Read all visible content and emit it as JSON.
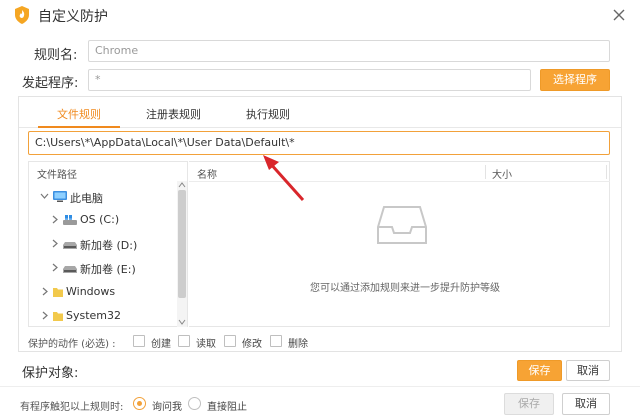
{
  "window": {
    "title": "自定义防护",
    "close_icon": "close-icon",
    "app_icon": "shield-icon",
    "app_icon_color": "#f5a623"
  },
  "form": {
    "rule_name_label": "规则名:",
    "rule_name_value": "Chrome",
    "process_label": "发起程序:",
    "process_value": "*",
    "select_program_button": "选择程序"
  },
  "tabs": [
    {
      "label": "文件规则",
      "active": true
    },
    {
      "label": "注册表规则",
      "active": false
    },
    {
      "label": "执行规则",
      "active": false
    }
  ],
  "path_input": {
    "value": "C:\\Users\\*\\AppData\\Local\\*\\User Data\\Default\\*"
  },
  "tree": {
    "header": "文件路径",
    "items": [
      {
        "label": "此电脑",
        "icon": "computer-icon",
        "caret": "expanded"
      },
      {
        "label": "OS (C:)",
        "icon": "os-drive-icon",
        "caret": "collapsed"
      },
      {
        "label": "新加卷 (D:)",
        "icon": "drive-icon",
        "caret": "collapsed"
      },
      {
        "label": "新加卷 (E:)",
        "icon": "drive-icon",
        "caret": "collapsed"
      },
      {
        "label": "Windows",
        "icon": "folder-icon",
        "caret": "collapsed"
      },
      {
        "label": "System32",
        "icon": "folder-icon",
        "caret": "collapsed"
      }
    ]
  },
  "list": {
    "columns": [
      "名称",
      "大小"
    ],
    "empty_text": "您可以通过添加规则来进一步提升防护等级",
    "empty_icon": "empty-tray-icon"
  },
  "actions": {
    "label": "保护的动作 (必选) :",
    "options": [
      "创建",
      "读取",
      "修改",
      "删除"
    ]
  },
  "protect_target": {
    "label": "保护对象:",
    "save": "保存",
    "cancel": "取消"
  },
  "trigger": {
    "label": "有程序触犯以上规则时:",
    "options": [
      {
        "label": "询问我",
        "selected": true
      },
      {
        "label": "直接阻止",
        "selected": false
      }
    ],
    "save": "保存",
    "cancel": "取消"
  },
  "colors": {
    "accent": "#f7a334",
    "annotation_arrow": "#d9262b"
  }
}
